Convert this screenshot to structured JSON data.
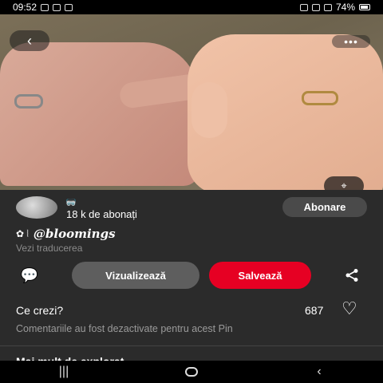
{
  "status_bar": {
    "time": "09:52",
    "battery": "74%"
  },
  "photo": {
    "back_glyph": "‹",
    "more_glyph": "•••",
    "lens_glyph": "⌖"
  },
  "creator": {
    "name_glyph": "🥽",
    "followers": "18 k de abonați",
    "follow_label": "Abonare"
  },
  "pin": {
    "title_icons": "✿ ⦚",
    "title": "@bloomings",
    "translate_label": "Vezi traducerea"
  },
  "actions": {
    "comment_glyph": "💬",
    "view_label": "Vizualizează",
    "save_label": "Salvează",
    "share_glyph": "⋖"
  },
  "comments": {
    "prompt": "Ce crezi?",
    "like_count": "687",
    "heart_glyph": "♡",
    "disabled_text": "Comentariile au fost dezactivate pentru acest Pin"
  },
  "explore": {
    "title": "Mai mult de explorat"
  },
  "nav": {
    "recent_glyph": "|||",
    "back_glyph": "‹"
  },
  "colors": {
    "save": "#e60023",
    "background": "#2b2b2b"
  }
}
